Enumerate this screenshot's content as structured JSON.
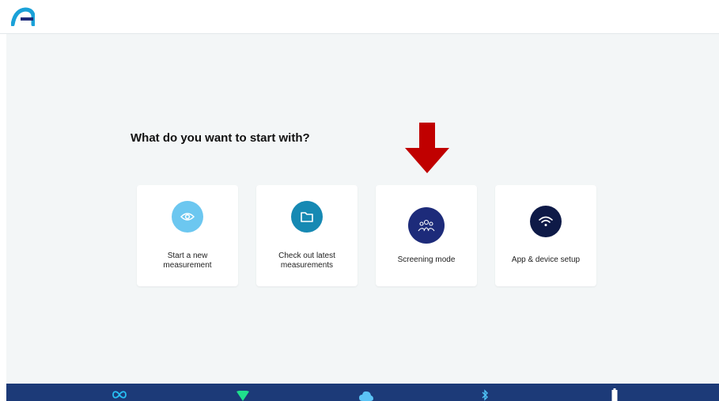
{
  "colors": {
    "accent": "#1aa1d8",
    "eye_circle": "#6cc7f0",
    "folder_circle": "#1689b3",
    "screening_circle": "#1d2b7a",
    "setup_circle": "#0e1a47",
    "arrow": "#c00000",
    "bottom_bar": "#1c3a78"
  },
  "header": {
    "logo": "brand-logo"
  },
  "main": {
    "title": "What do you want to start with?",
    "cards": [
      {
        "icon": "eye-icon",
        "label_lines": [
          "Start a new",
          "measurement"
        ]
      },
      {
        "icon": "folder-icon",
        "label_lines": [
          "Check out latest",
          "measurements"
        ]
      },
      {
        "icon": "group-icon",
        "label_lines": [
          "Screening mode"
        ]
      },
      {
        "icon": "wifi-icon",
        "label_lines": [
          "App & device setup"
        ]
      }
    ]
  },
  "status_bar": {
    "icons": [
      "infinity-icon",
      "wifi-signal-icon",
      "cloud-icon",
      "bluetooth-icon",
      "battery-icon"
    ]
  }
}
